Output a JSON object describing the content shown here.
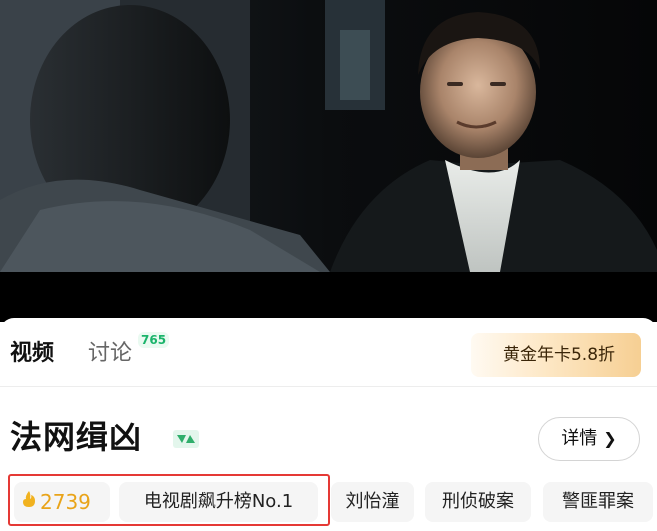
{
  "video": {
    "scene": "drama still"
  },
  "tabs": [
    {
      "label": "视频"
    },
    {
      "label": "讨论",
      "badge": "765"
    }
  ],
  "vip": {
    "label": "黄金年卡5.8折"
  },
  "show": {
    "title": "法网缉凶"
  },
  "detail": {
    "label": "详情",
    "icon": "chevron-right-icon"
  },
  "tags": {
    "heat": {
      "icon": "flame-icon",
      "value": "2739"
    },
    "rank": "电视剧飙升榜No.1",
    "actor": "刘怡潼",
    "genre1": "刑侦破案",
    "genre2": "警匪罪案"
  },
  "colors": {
    "heat": "#e9a419",
    "badge": "#1bb46b",
    "highlight": "#e53935",
    "vip_gradient_end": "#f6cf93"
  }
}
